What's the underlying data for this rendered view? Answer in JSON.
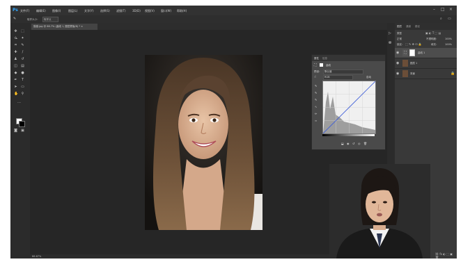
{
  "app": {
    "logo": "Ps"
  },
  "menu": [
    "文件(F)",
    "编辑(E)",
    "图像(I)",
    "图层(L)",
    "文字(Y)",
    "选择(S)",
    "滤镜(T)",
    "3D(D)",
    "视图(V)",
    "窗口(W)",
    "帮助(H)"
  ],
  "window_controls": [
    "–",
    "□",
    "×"
  ],
  "options_bar": {
    "sample_label": "取样大小：",
    "sample_value": "取样点"
  },
  "document_tab": {
    "title": "猫猫.jpg @ 66.7% (曲线 1, 图层蒙版/8) * ×"
  },
  "status_bar": {
    "zoom": "66.67%"
  },
  "properties_panel": {
    "tabs": [
      "属性",
      "信息"
    ],
    "adjustment": "曲线",
    "preset_label": "预设：",
    "preset_value": "默认值",
    "channel_value": "RGB",
    "auto_label": "自动"
  },
  "layers_panel": {
    "tabs": [
      "图层",
      "通道",
      "路径"
    ],
    "kind_label": "类型",
    "blend_mode": "正常",
    "opacity_label": "不透明度：",
    "opacity_value": "100%",
    "lock_label": "锁定：",
    "fill_label": "填充：",
    "fill_value": "100%",
    "layers": [
      {
        "name": "曲线 1",
        "type": "adjustment",
        "selected": true
      },
      {
        "name": "图层 1",
        "type": "image",
        "selected": false
      },
      {
        "name": "背景",
        "type": "image",
        "selected": false
      }
    ]
  },
  "colors": {
    "accent": "#31a8ff",
    "ui_dark": "#2b2b2b",
    "canvas": "#262626"
  }
}
